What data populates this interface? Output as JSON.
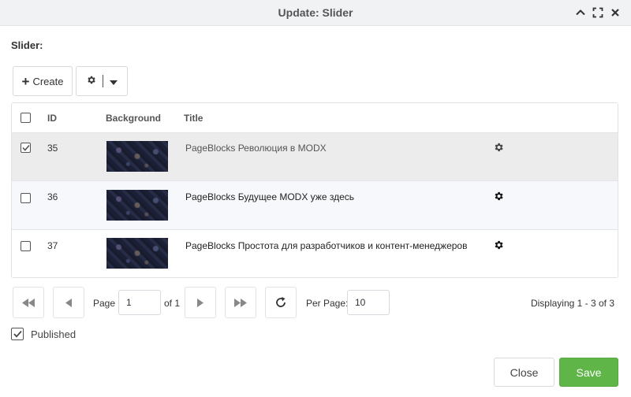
{
  "window": {
    "title": "Update: Slider",
    "tools": [
      "collapse-icon",
      "fullscreen-icon",
      "close-icon"
    ]
  },
  "section_label": "Slider:",
  "toolbar": {
    "create_label": "Create",
    "create_icon": "plus-icon",
    "actions_icon": "gear-icon",
    "actions_dropdown_icon": "caret-down-icon"
  },
  "grid": {
    "columns": [
      "ID",
      "Background",
      "Title"
    ],
    "rows": [
      {
        "id": "35",
        "title": "PageBlocks Революция в MODX",
        "checked": true
      },
      {
        "id": "36",
        "title": "PageBlocks Будущее MODX уже здесь",
        "checked": false
      },
      {
        "id": "37",
        "title": "PageBlocks Простота для разработчиков и контент-менеджеров",
        "checked": false
      }
    ]
  },
  "pager": {
    "page_label": "Page",
    "page_value": "1",
    "of_label": "of 1",
    "per_page_label": "Per Page:",
    "per_page_value": "10",
    "displaying": "Displaying 1 - 3 of 3"
  },
  "published": {
    "label": "Published",
    "checked": true
  },
  "footer": {
    "close_label": "Close",
    "save_label": "Save"
  },
  "colors": {
    "save_green": "#5fb547",
    "titlebar_bg": "#f1f2f4",
    "selected_row_bg": "#ececec"
  }
}
